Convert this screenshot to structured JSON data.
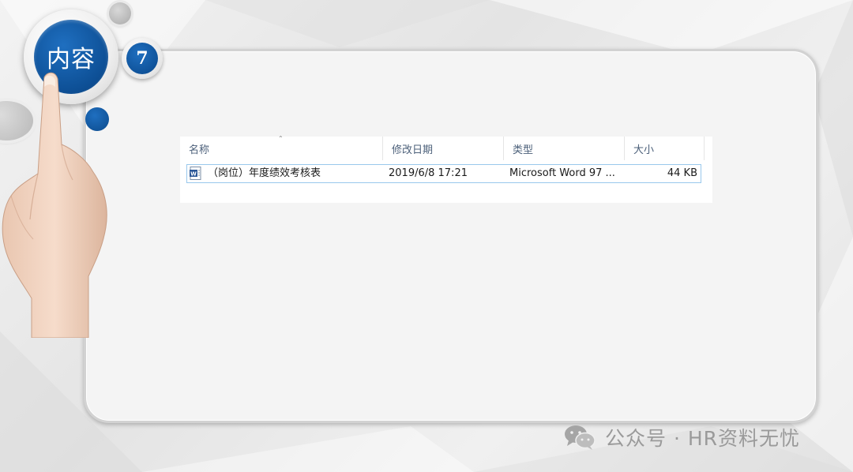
{
  "slide": {
    "title": "内容",
    "number": "7"
  },
  "explorer": {
    "columns": {
      "name": "名称",
      "modified": "修改日期",
      "type": "类型",
      "size": "大小"
    },
    "files": [
      {
        "icon": "word-document-icon",
        "name": "（岗位）年度绩效考核表",
        "modified": "2019/6/8 17:21",
        "type": "Microsoft Word 97 ...",
        "size": "44 KB"
      }
    ]
  },
  "watermark": {
    "icon": "wechat-icon",
    "text": "公众号 · HR资料无忧"
  },
  "colors": {
    "accent_blue": "#0d4f95",
    "selection_border": "#99c8ec",
    "header_text": "#4c607a",
    "watermark_gray": "#9a9a9a"
  }
}
